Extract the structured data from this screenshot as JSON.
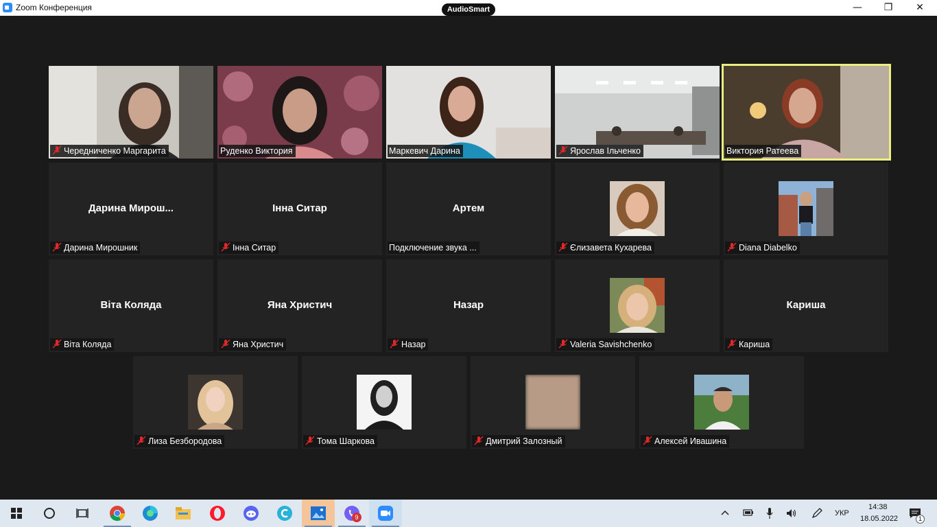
{
  "window": {
    "title": "Zoom Конференция",
    "badge": "AudioSmart",
    "minimize": "—",
    "restore": "❐",
    "close": "✕"
  },
  "participants_row1": [
    {
      "label": "Чередниченко Маргарита"
    },
    {
      "label": "Руденко  Виктория"
    },
    {
      "label": "Маркевич Дарина"
    },
    {
      "label": "Ярослав Ільченко"
    },
    {
      "label": "Виктория Ратеева"
    }
  ],
  "participants_row2": [
    {
      "center": "Дарина  Мирош...",
      "label": "Дарина Мирошник"
    },
    {
      "center": "Інна Ситар",
      "label": "Інна Ситар"
    },
    {
      "center": "Артем",
      "label": "Подключение звука ..."
    },
    {
      "label": "Єлизавета Кухарева"
    },
    {
      "label": "Diana Diabelko"
    }
  ],
  "participants_row3": [
    {
      "center": "Віта Коляда",
      "label": "Віта Коляда"
    },
    {
      "center": "Яна Христич",
      "label": "Яна Христич"
    },
    {
      "center": "Назар",
      "label": "Назар"
    },
    {
      "label": "Valeria Savishchenko"
    },
    {
      "center": "Кариша",
      "label": "Кариша"
    }
  ],
  "participants_row4": [
    {
      "label": "Лиза Безбородова"
    },
    {
      "label": "Тома Шаркова"
    },
    {
      "label": "Дмитрий Залозный"
    },
    {
      "label": "Алексей Ивашина"
    }
  ],
  "taskbar": {
    "language": "УКР",
    "time": "14:38",
    "date": "18.05.2022",
    "viber_badge": "9",
    "notification_count": "1"
  },
  "colors": {
    "active_speaker_border": "#e9f082",
    "tile_bg": "#232323",
    "stage_bg": "#1a1a1a",
    "taskbar_bg": "#dfe8f0"
  }
}
